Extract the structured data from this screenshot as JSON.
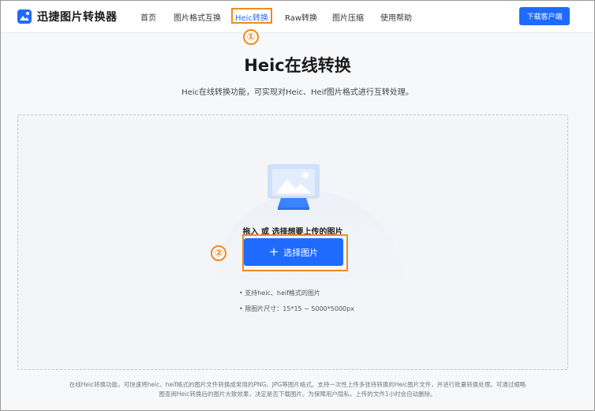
{
  "header": {
    "logo_text": "迅捷图片转换器",
    "nav": [
      "首页",
      "图片格式互换",
      "Heic转换",
      "Raw转换",
      "图片压缩",
      "使用帮助"
    ],
    "download_label": "下载客户端"
  },
  "annotations": {
    "step1": "①",
    "step2": "②"
  },
  "main": {
    "title": "Heic在线转换",
    "subtitle": "Heic在线转换功能，可实现对Heic、Heif图片格式进行互转处理。",
    "drop_hint": "拖入 或 选择想要上传的图片",
    "plus_glyph": "+",
    "select_label": "选择图片",
    "notes": [
      "• 支持heic、heif格式的图片",
      "• 限图片尺寸：15*15 ~ 5000*5000px"
    ]
  },
  "footer": {
    "line1": "在线Heic转换功能，可快速将heic、heif格式的图片文件转换成常用的PNG、JPG等图片格式。支持一次性上传多张待转换的Heic图片文件，并进行批量转换处理。可通过缩略",
    "line2": "图查阅Heic转换后的图片大致效果，决定是否下载图片。为保障用户隐私，上传的文件1小时会自动删除。"
  },
  "colors": {
    "accent": "#1f6bff",
    "annotation": "#f08a1e"
  },
  "icons": {
    "logo": "image-convert-icon",
    "upload": "upload-image-illustration",
    "plus": "plus-icon"
  }
}
